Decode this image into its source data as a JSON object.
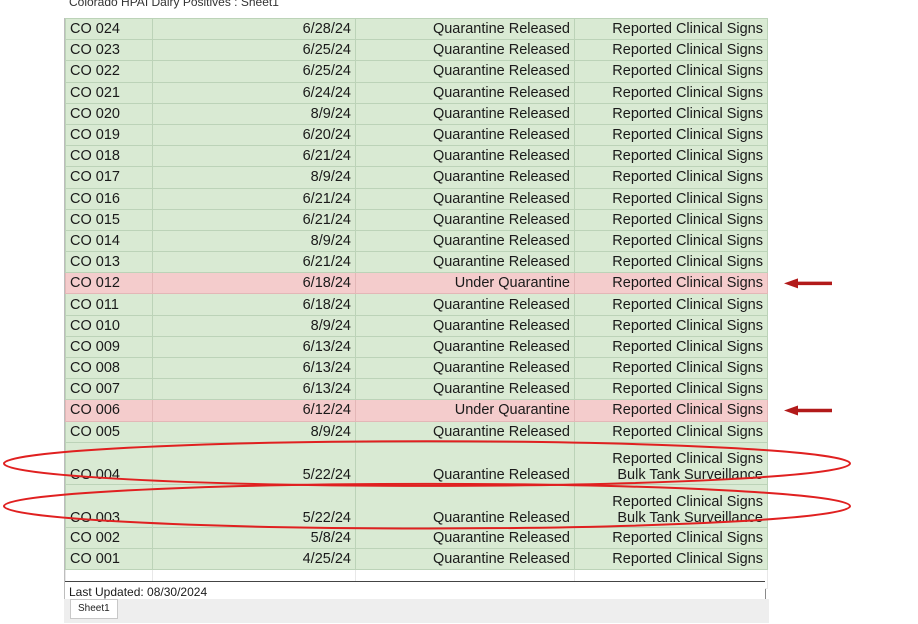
{
  "window": {
    "title": "Colorado HPAI Dairy Positives : Sheet1"
  },
  "rows": [
    {
      "id": "CO 024",
      "date": "6/28/24",
      "status": "Quarantine Released",
      "reason": [
        "Reported Clinical Signs"
      ],
      "highlight": "green"
    },
    {
      "id": "CO 023",
      "date": "6/25/24",
      "status": "Quarantine Released",
      "reason": [
        "Reported Clinical Signs"
      ],
      "highlight": "green"
    },
    {
      "id": "CO 022",
      "date": "6/25/24",
      "status": "Quarantine Released",
      "reason": [
        "Reported Clinical Signs"
      ],
      "highlight": "green"
    },
    {
      "id": "CO 021",
      "date": "6/24/24",
      "status": "Quarantine Released",
      "reason": [
        "Reported Clinical Signs"
      ],
      "highlight": "green"
    },
    {
      "id": "CO 020",
      "date": "8/9/24",
      "status": "Quarantine Released",
      "reason": [
        "Reported Clinical Signs"
      ],
      "highlight": "green"
    },
    {
      "id": "CO 019",
      "date": "6/20/24",
      "status": "Quarantine Released",
      "reason": [
        "Reported Clinical Signs"
      ],
      "highlight": "green"
    },
    {
      "id": "CO 018",
      "date": "6/21/24",
      "status": "Quarantine Released",
      "reason": [
        "Reported Clinical Signs"
      ],
      "highlight": "green"
    },
    {
      "id": "CO 017",
      "date": "8/9/24",
      "status": "Quarantine Released",
      "reason": [
        "Reported Clinical Signs"
      ],
      "highlight": "green"
    },
    {
      "id": "CO 016",
      "date": "6/21/24",
      "status": "Quarantine Released",
      "reason": [
        "Reported Clinical Signs"
      ],
      "highlight": "green"
    },
    {
      "id": "CO 015",
      "date": "6/21/24",
      "status": "Quarantine Released",
      "reason": [
        "Reported Clinical Signs"
      ],
      "highlight": "green"
    },
    {
      "id": "CO 014",
      "date": "8/9/24",
      "status": "Quarantine Released",
      "reason": [
        "Reported Clinical Signs"
      ],
      "highlight": "green"
    },
    {
      "id": "CO 013",
      "date": "6/21/24",
      "status": "Quarantine Released",
      "reason": [
        "Reported Clinical Signs"
      ],
      "highlight": "green"
    },
    {
      "id": "CO 012",
      "date": "6/18/24",
      "status": "Under Quarantine",
      "reason": [
        "Reported Clinical Signs"
      ],
      "highlight": "red",
      "annotation": "arrow"
    },
    {
      "id": "CO 011",
      "date": "6/18/24",
      "status": "Quarantine Released",
      "reason": [
        "Reported Clinical Signs"
      ],
      "highlight": "green"
    },
    {
      "id": "CO 010",
      "date": "8/9/24",
      "status": "Quarantine Released",
      "reason": [
        "Reported Clinical Signs"
      ],
      "highlight": "green"
    },
    {
      "id": "CO 009",
      "date": "6/13/24",
      "status": "Quarantine Released",
      "reason": [
        "Reported Clinical Signs"
      ],
      "highlight": "green"
    },
    {
      "id": "CO 008",
      "date": "6/13/24",
      "status": "Quarantine Released",
      "reason": [
        "Reported Clinical Signs"
      ],
      "highlight": "green"
    },
    {
      "id": "CO 007",
      "date": "6/13/24",
      "status": "Quarantine Released",
      "reason": [
        "Reported Clinical Signs"
      ],
      "highlight": "green"
    },
    {
      "id": "CO 006",
      "date": "6/12/24",
      "status": "Under Quarantine",
      "reason": [
        "Reported Clinical Signs"
      ],
      "highlight": "red",
      "annotation": "arrow"
    },
    {
      "id": "CO 005",
      "date": "8/9/24",
      "status": "Quarantine Released",
      "reason": [
        "Reported Clinical Signs"
      ],
      "highlight": "green"
    },
    {
      "id": "CO 004",
      "date": "5/22/24",
      "status": "Quarantine Released",
      "reason": [
        "Reported Clinical Signs",
        "Bulk Tank Surveillance"
      ],
      "highlight": "green",
      "annotation": "ellipse"
    },
    {
      "id": "CO 003",
      "date": "5/22/24",
      "status": "Quarantine Released",
      "reason": [
        "Reported Clinical Signs",
        "Bulk Tank Surveillance"
      ],
      "highlight": "green",
      "annotation": "ellipse"
    },
    {
      "id": "CO 002",
      "date": "5/8/24",
      "status": "Quarantine Released",
      "reason": [
        "Reported Clinical Signs"
      ],
      "highlight": "green"
    },
    {
      "id": "CO 001",
      "date": "4/25/24",
      "status": "Quarantine Released",
      "reason": [
        "Reported Clinical Signs"
      ],
      "highlight": "green"
    }
  ],
  "footer": {
    "last_updated": "Last Updated: 08/30/2024"
  },
  "tabs": [
    {
      "label": "Sheet1"
    }
  ],
  "colors": {
    "released": "#d9ead3",
    "quarantine": "#f4cccc",
    "annotation": "#e02020",
    "arrow": "#b21a1a"
  }
}
